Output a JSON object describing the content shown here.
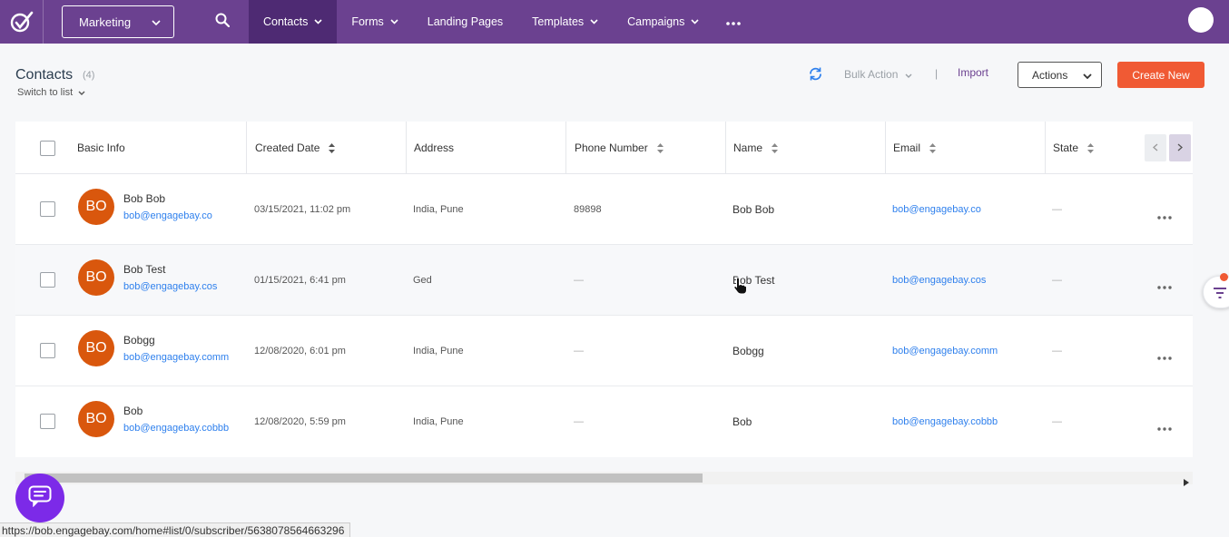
{
  "nav": {
    "workspace": "Marketing",
    "items": [
      {
        "label": "Contacts",
        "dropdown": true,
        "active": true
      },
      {
        "label": "Forms",
        "dropdown": true
      },
      {
        "label": "Landing Pages",
        "dropdown": false
      },
      {
        "label": "Templates",
        "dropdown": true
      },
      {
        "label": "Campaigns",
        "dropdown": true
      }
    ],
    "more_icon": "ellipsis-icon",
    "colors": {
      "bar": "#6b4190",
      "active": "#4e2a73"
    }
  },
  "header": {
    "title": "Contacts",
    "count": "(4)",
    "switch_label": "Switch to list",
    "bulk_action": "Bulk Action",
    "separator": "|",
    "import": "Import",
    "actions": "Actions",
    "create_new": "Create New"
  },
  "table": {
    "columns": [
      "Basic Info",
      "Created Date",
      "Address",
      "Phone Number",
      "Name",
      "Email",
      "State"
    ],
    "rows": [
      {
        "initials": "BO",
        "name": "Bob Bob",
        "email": "bob@engagebay.co",
        "created": "03/15/2021, 11:02 pm",
        "address": "India, Pune",
        "phone": "89898",
        "full_name": "Bob Bob",
        "email2": "bob@engagebay.co",
        "state": "—"
      },
      {
        "initials": "BO",
        "name": "Bob Test",
        "email": "bob@engagebay.cos",
        "created": "01/15/2021, 6:41 pm",
        "address": "Ged",
        "phone": "—",
        "full_name": "Bob Test",
        "email2": "bob@engagebay.cos",
        "state": "—"
      },
      {
        "initials": "BO",
        "name": "Bobgg",
        "email": "bob@engagebay.comm",
        "created": "12/08/2020, 6:01 pm",
        "address": "India, Pune",
        "phone": "—",
        "full_name": "Bobgg",
        "email2": "bob@engagebay.comm",
        "state": "—"
      },
      {
        "initials": "BO",
        "name": "Bob",
        "email": "bob@engagebay.cobbb",
        "created": "12/08/2020, 5:59 pm",
        "address": "India, Pune",
        "phone": "—",
        "full_name": "Bob",
        "email2": "bob@engagebay.cobbb",
        "state": "—"
      }
    ]
  },
  "status_url": "https://bob.engagebay.com/home#list/0/subscriber/5638078564663296",
  "accent": {
    "create": "#f05a34",
    "avatar": "#d9570d",
    "link": "#2f80ed",
    "chat": "#7c2ae8"
  }
}
